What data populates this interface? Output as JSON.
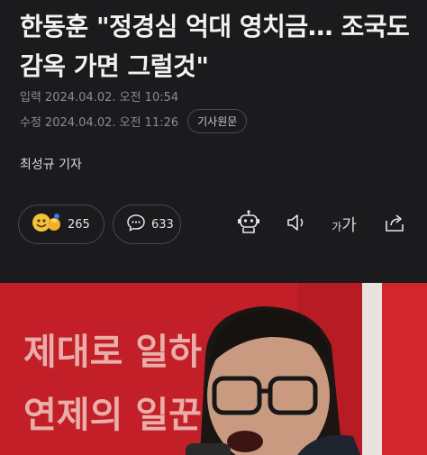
{
  "article": {
    "headline": "한동훈 \"정경심 억대 영치금… 조국도 감옥 가면 그럴것\"",
    "input_label": "입력",
    "input_time": "2024.04.02. 오전 10:54",
    "edit_label": "수정",
    "edit_time": "2024.04.02. 오전 11:26",
    "original_button": "기사원문",
    "reporter": "최성규 기자"
  },
  "actions": {
    "reaction_count": "265",
    "comment_count": "633",
    "font_small": "가",
    "font_large": "가"
  },
  "photo": {
    "banner_line1": "제대로 일하",
    "banner_line2": "연제의 일꾼"
  },
  "colors": {
    "background": "#1b1b1d",
    "banner_red": "#c8202a"
  }
}
